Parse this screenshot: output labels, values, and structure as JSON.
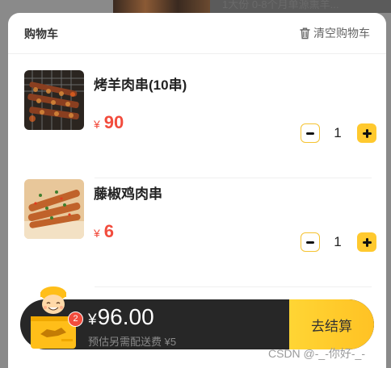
{
  "background": {
    "snippet_text": "1大份 0-8个月单源熏羊..."
  },
  "header": {
    "title": "购物车",
    "clear_label": "清空购物车"
  },
  "items": [
    {
      "name": "烤羊肉串(10串)",
      "currency": "¥",
      "price": "90",
      "quantity": "1"
    },
    {
      "name": "藤椒鸡肉串",
      "currency": "¥",
      "price": "6",
      "quantity": "1"
    }
  ],
  "footer": {
    "badge_count": "2",
    "currency": "¥",
    "total": "96.00",
    "delivery_note": "预估另需配送费 ¥5",
    "checkout_label": "去结算"
  },
  "watermark": "CSDN @-_-你好-_-",
  "colors": {
    "accent_yellow": "#ffc92e",
    "price_red": "#f24c3d",
    "bar_dark": "#272727"
  },
  "icons": [
    "trash-icon",
    "minus-icon",
    "plus-icon",
    "delivery-mascot-icon"
  ]
}
